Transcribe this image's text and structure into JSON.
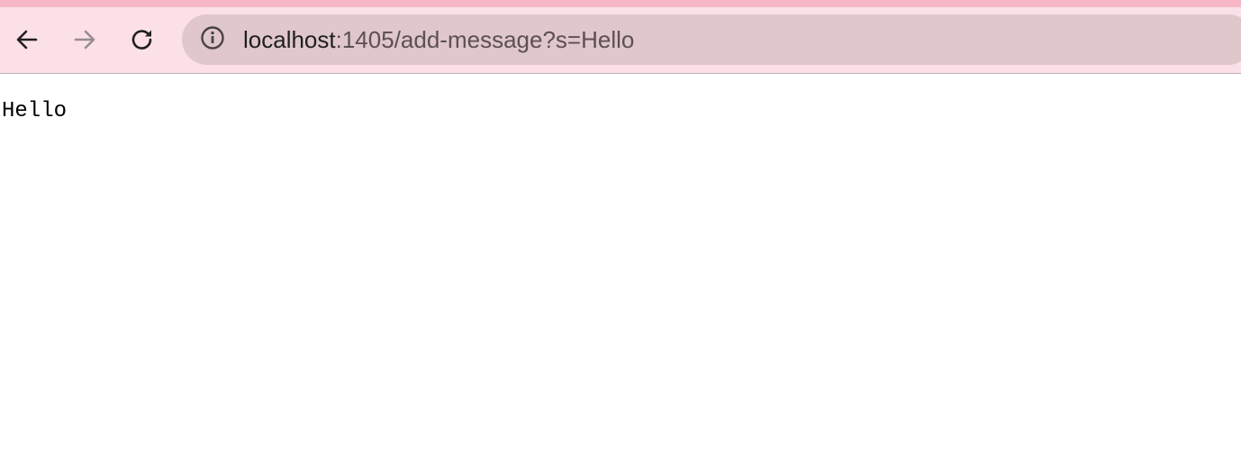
{
  "browser": {
    "nav": {
      "back_icon": "arrow-left-icon",
      "forward_icon": "arrow-right-icon",
      "reload_icon": "reload-icon"
    },
    "omnibox": {
      "site_info_icon": "info-circle-icon",
      "url_host": "localhost",
      "url_rest": ":1405/add-message?s=Hello"
    },
    "colors": {
      "toolbar_bg": "#fbe0e7",
      "tabstrip_edge": "#f7b6c5",
      "omnibox_bg": "#dfc7cb"
    }
  },
  "page": {
    "text": "Hello"
  }
}
